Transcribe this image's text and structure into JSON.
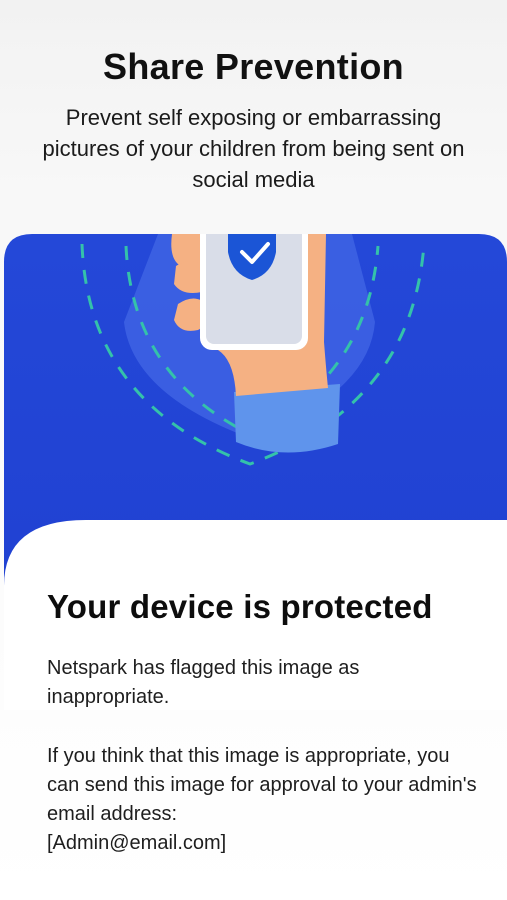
{
  "screen": {
    "title": "Share Prevention",
    "subtitle": "Prevent self exposing or embarrassing pictures of your children from being sent on social media"
  },
  "illustration": {
    "name": "protected-phone-illustration",
    "colors": {
      "background_top": "#2448d8",
      "background_bottom": "#1f3fd0",
      "shield": "#3f64e4",
      "hand": "#f5b183",
      "sleeve": "#5f94ec",
      "phone_screen": "#d9dde8",
      "check_badge": "#1b55d6",
      "signal_arcs": "#34c2aa"
    }
  },
  "card": {
    "title": "Your device is protected",
    "message": "Netspark has flagged this image as inappropriate.",
    "instructions": "If you think that this image is appropriate, you can send this image for approval to your admin's email address:",
    "admin_email": "[Admin@email.com]"
  }
}
